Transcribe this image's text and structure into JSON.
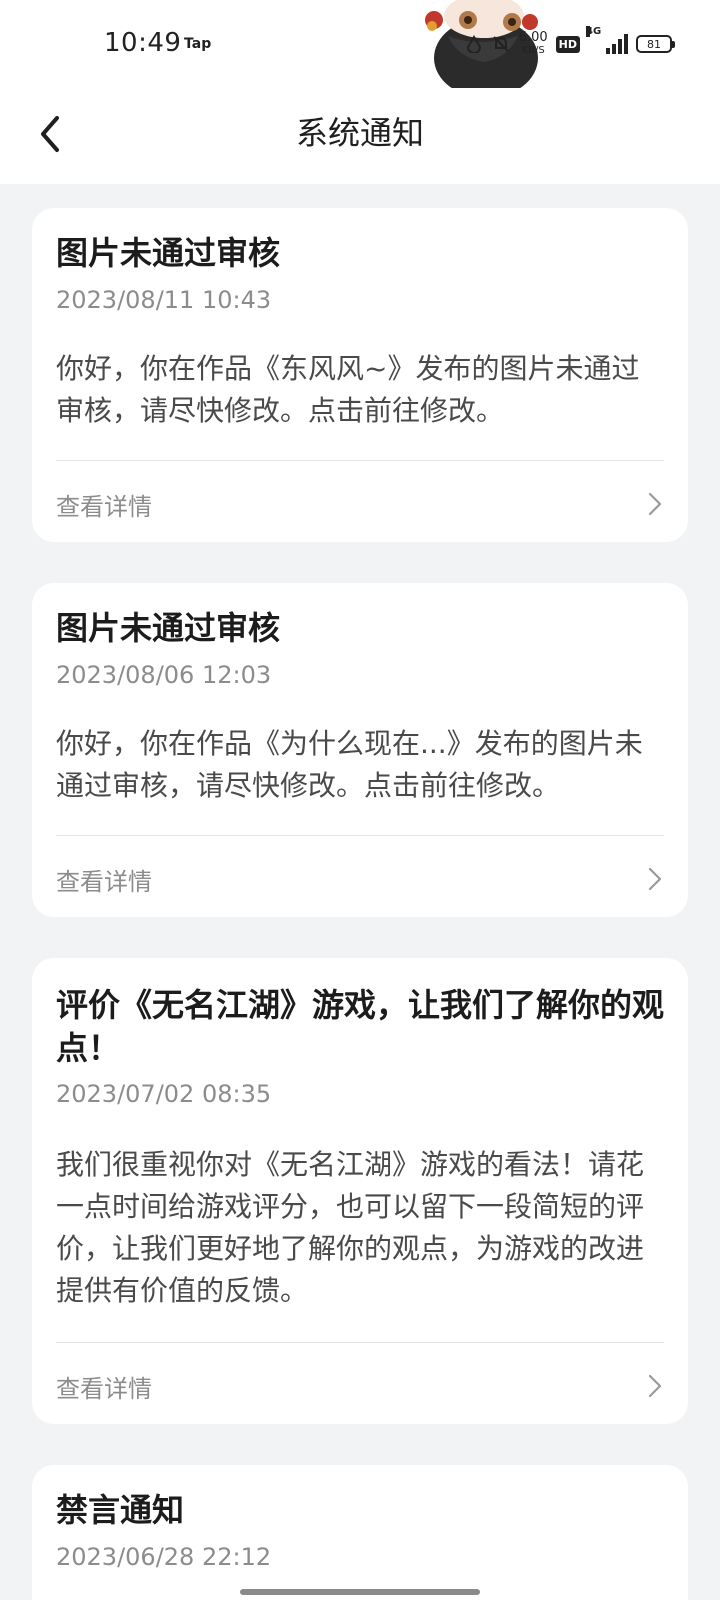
{
  "status_bar": {
    "time": "10:49",
    "app_label": "Tap",
    "speed_value": "6.00",
    "speed_unit": "KB/S",
    "hd_badge": "HD",
    "network": "4G",
    "battery": "81"
  },
  "header": {
    "title": "系统通知",
    "back_icon": "chevron-left-icon"
  },
  "notifications": [
    {
      "title": "图片未通过审核",
      "date": "2023/08/11 10:43",
      "body": "你好，你在作品《东风风~》发布的图片未通过审核，请尽快修改。点击前往修改。",
      "link_label": "查看详情"
    },
    {
      "title": "图片未通过审核",
      "date": "2023/08/06 12:03",
      "body": "你好，你在作品《为什么现在...》发布的图片未通过审核，请尽快修改。点击前往修改。",
      "link_label": "查看详情"
    },
    {
      "title": "评价《无名江湖》游戏，让我们了解你的观点！",
      "date": "2023/07/02 08:35",
      "body": "我们很重视你对《无名江湖》游戏的看法！请花一点时间给游戏评分，也可以留下一段简短的评价，让我们更好地了解你的观点，为游戏的改进提供有价值的反馈。",
      "link_label": "查看详情"
    },
    {
      "title": "禁言通知",
      "date": "2023/06/28 22:12"
    }
  ],
  "colors": {
    "background": "#f2f3f5",
    "card": "#ffffff",
    "title_text": "#1c1c1c",
    "secondary_text": "#8c8c8c",
    "body_text": "#4a4a4a"
  }
}
